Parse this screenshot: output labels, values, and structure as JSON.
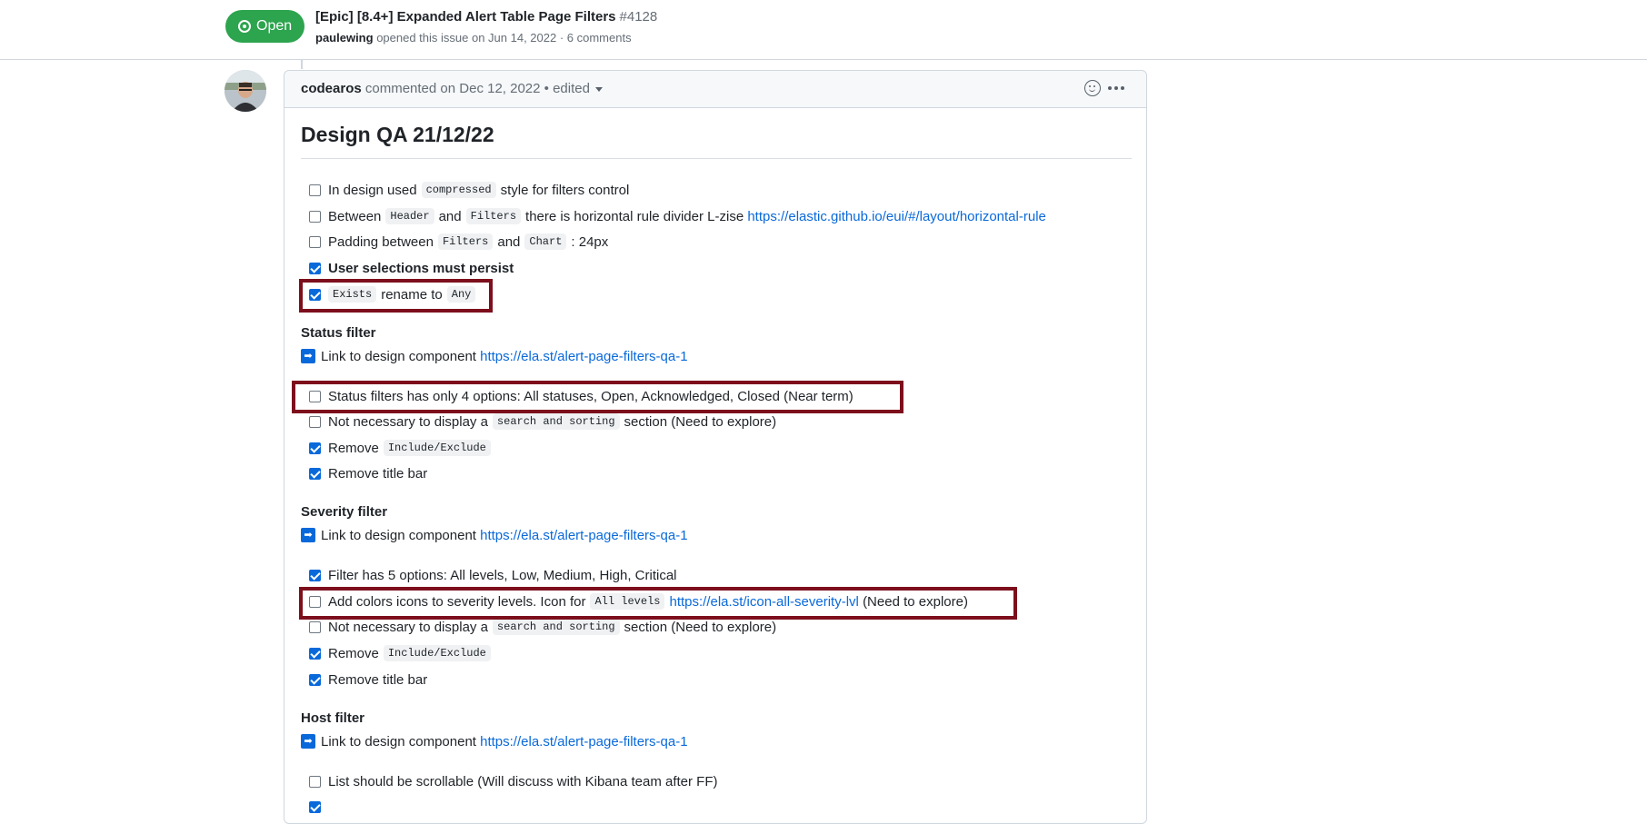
{
  "issue": {
    "state": "Open",
    "title": "[Epic] [8.4+] Expanded Alert Table Page Filters",
    "number": "#4128",
    "author": "paulewing",
    "meta_rest": "opened this issue on Jun 14, 2022 · 6 comments"
  },
  "comment": {
    "author": "codearos",
    "meta": "commented on Dec 12, 2022 • edited",
    "heading": "Design QA 21/12/22"
  },
  "tasks": {
    "t1": {
      "a": "In design used",
      "code": "compressed",
      "b": "style for filters control",
      "checked": false
    },
    "t2": {
      "a": "Between",
      "code1": "Header",
      "and": "and",
      "code2": "Filters",
      "b": "there is horizontal rule divider L-zise",
      "link": "https://elastic.github.io/eui/#/layout/horizontal-rule",
      "checked": false
    },
    "t3": {
      "a": "Padding between",
      "code1": "Filters",
      "and": "and",
      "code2": "Chart",
      "b": ": 24px",
      "checked": false
    },
    "t4": {
      "text": "User selections must persist",
      "checked": true
    },
    "t5": {
      "code1": "Exists",
      "mid": "rename to",
      "code2": "Any",
      "checked": true
    }
  },
  "status_filter": {
    "title": "Status filter",
    "link_label": "Link to design component",
    "link": "https://ela.st/alert-page-filters-qa-1",
    "items": {
      "s1": "Status filters has only 4 options: All statuses, Open, Acknowledged, Closed (Near term)",
      "s2a": "Not necessary to display a",
      "s2code": "search and sorting",
      "s2b": "section (Need to explore)",
      "s3a": "Remove",
      "s3code": "Include/Exclude",
      "s4": "Remove title bar"
    }
  },
  "severity_filter": {
    "title": "Severity filter",
    "link_label": "Link to design component",
    "link": "https://ela.st/alert-page-filters-qa-1",
    "items": {
      "v1": "Filter has 5 options: All levels, Low, Medium, High, Critical",
      "v2a": "Add colors icons to severity levels. Icon for",
      "v2code": "All levels",
      "v2link": "https://ela.st/icon-all-severity-lvl",
      "v2b": "(Need to explore)",
      "v3a": "Not necessary to display a",
      "v3code": "search and sorting",
      "v3b": "section (Need to explore)",
      "v4a": "Remove",
      "v4code": "Include/Exclude",
      "v5": "Remove title bar"
    }
  },
  "host_filter": {
    "title": "Host filter",
    "link_label": "Link to design component",
    "link": "https://ela.st/alert-page-filters-qa-1",
    "items": {
      "h1": "List should be scrollable (Will discuss with Kibana team after FF)"
    }
  },
  "colors": {
    "open_badge": "#2da44e",
    "link": "#0969da",
    "highlight": "#7d0f1c"
  }
}
